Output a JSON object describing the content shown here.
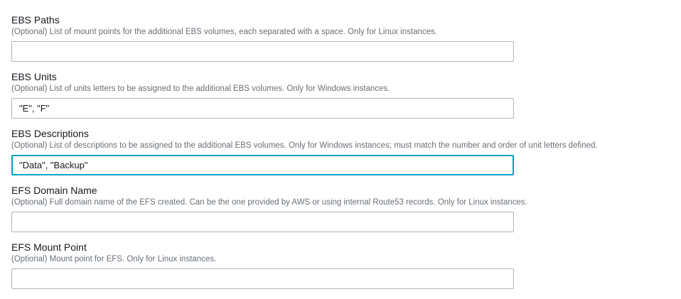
{
  "fields": [
    {
      "label": "EBS Paths",
      "description": "(Optional) List of mount points for the additional EBS volumes, each separated with a space. Only for Linux instances.",
      "value": ""
    },
    {
      "label": "EBS Units",
      "description": "(Optional) List of units letters to be assigned to the additional EBS volumes. Only for Windows instances.",
      "value": "\"E\", \"F\""
    },
    {
      "label": "EBS Descriptions",
      "description": "(Optional) List of descriptions to be assigned to the additional EBS volumes. Only for Windows instances; must match the number and order of unit letters defined.",
      "value": "\"Data\", \"Backup\"",
      "focused": true
    },
    {
      "label": "EFS Domain Name",
      "description": "(Optional) Full domain name of the EFS created. Can be the one provided by AWS or using internal Route53 records. Only for Linux instances.",
      "value": ""
    },
    {
      "label": "EFS Mount Point",
      "description": "(Optional) Mount point for EFS. Only for Linux instances.",
      "value": ""
    }
  ]
}
